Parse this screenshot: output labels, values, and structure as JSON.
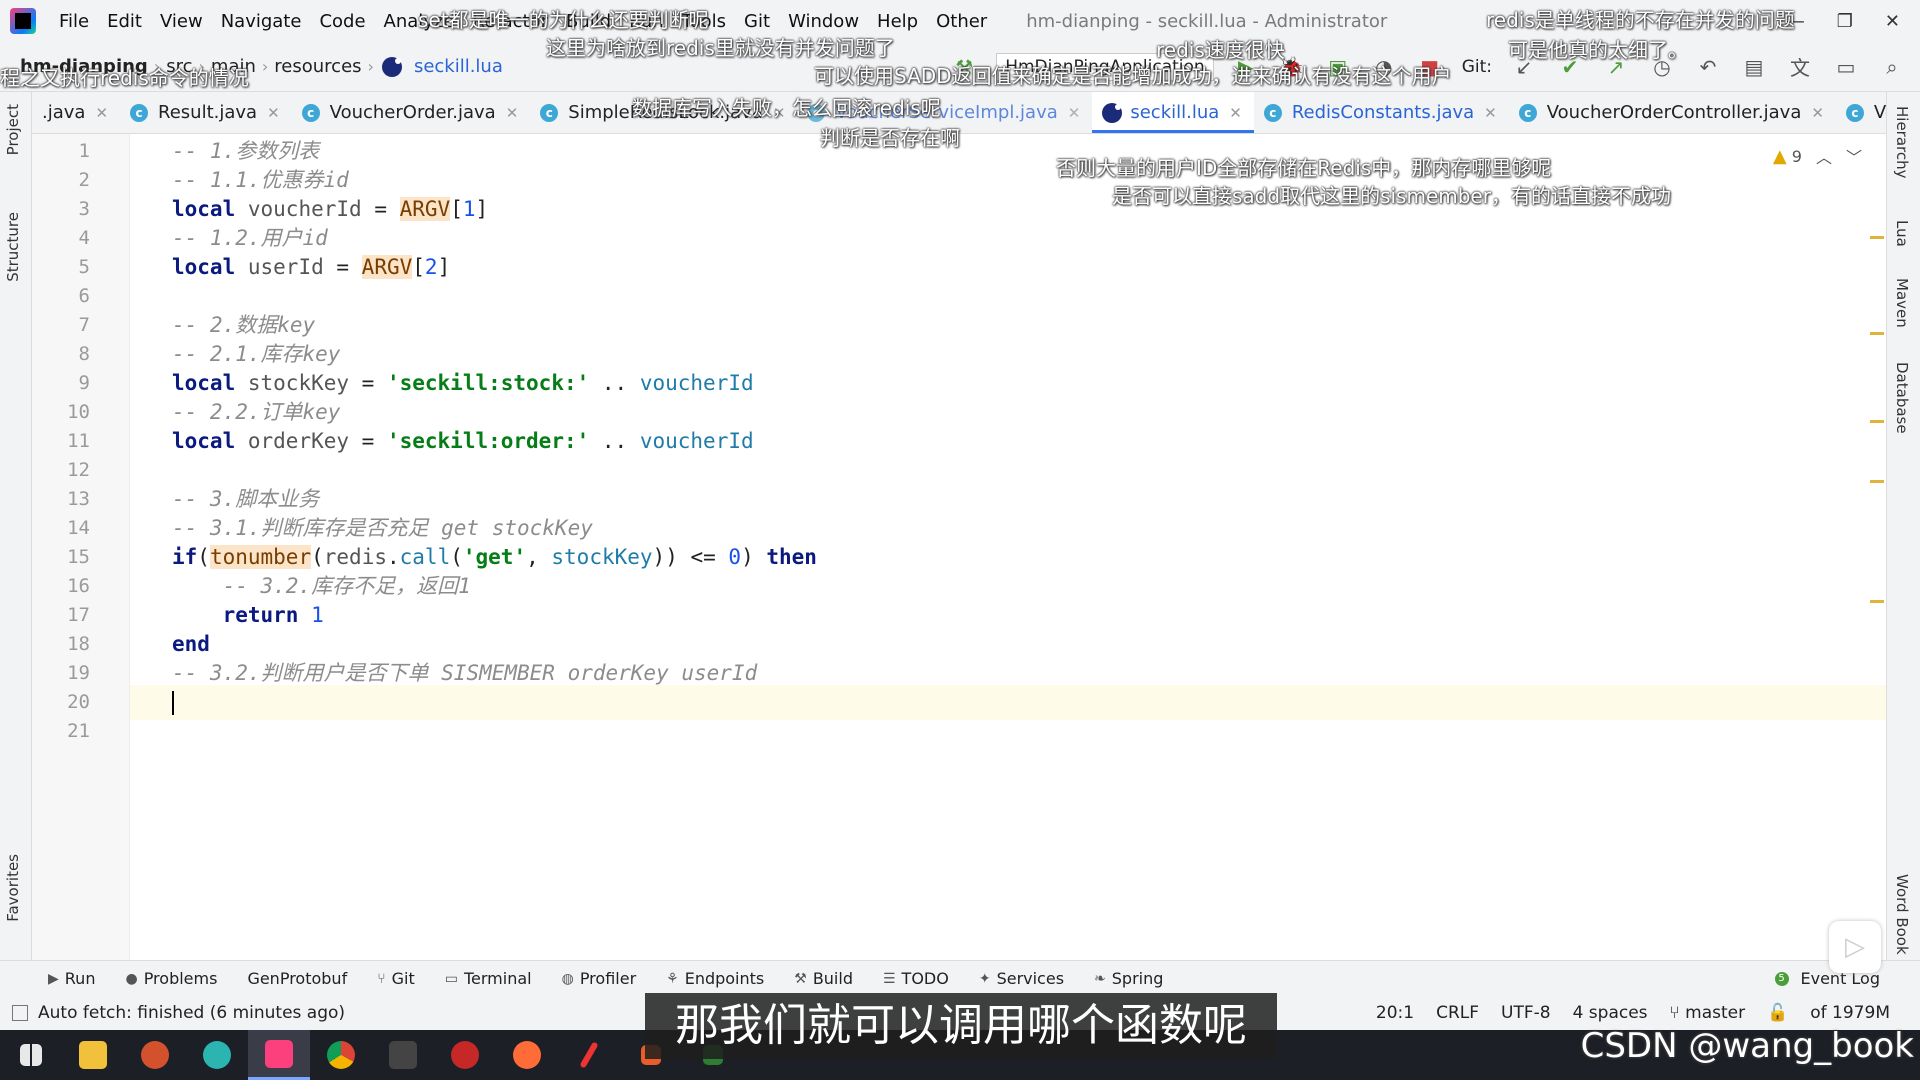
{
  "menubar": {
    "items": [
      "File",
      "Edit",
      "View",
      "Navigate",
      "Code",
      "Analyze",
      "Refactor",
      "Build",
      "Run",
      "Tools",
      "Git",
      "Window",
      "Help",
      "Other"
    ],
    "window_title": "hm-dianping - seckill.lua - Administrator"
  },
  "breadcrumb": {
    "items": [
      "hm-dianping",
      "src",
      "main",
      "resources"
    ],
    "file": "seckill.lua"
  },
  "toolbar": {
    "run_config": "HmDianPingApplication",
    "git_label": "Git:"
  },
  "tabs": [
    {
      "label": ".java",
      "type": "plain"
    },
    {
      "label": "Result.java",
      "type": "class"
    },
    {
      "label": "VoucherOrder.java",
      "type": "class"
    },
    {
      "label": "SimpleRedisLock.java",
      "type": "class"
    },
    {
      "label": "VoucherServiceImpl.java",
      "type": "class"
    },
    {
      "label": "seckill.lua",
      "type": "lua",
      "active": true
    },
    {
      "label": "RedisConstants.java",
      "type": "class"
    },
    {
      "label": "VoucherOrderController.java",
      "type": "class"
    },
    {
      "label": "Voucher",
      "type": "class"
    }
  ],
  "editor": {
    "warning_count": "9",
    "current_line": 20,
    "lines": [
      "-- 1.参数列表",
      "-- 1.1.优惠券id",
      "local voucherId = ARGV[1]",
      "-- 1.2.用户id",
      "local userId = ARGV[2]",
      "",
      "-- 2.数据key",
      "-- 2.1.库存key",
      "local stockKey = 'seckill:stock:' .. voucherId",
      "-- 2.2.订单key",
      "local orderKey = 'seckill:order:' .. voucherId",
      "",
      "-- 3.脚本业务",
      "-- 3.1.判断库存是否充足 get stockKey",
      "if(tonumber(redis.call('get', stockKey)) <= 0) then",
      "    -- 3.2.库存不足，返回1",
      "    return 1",
      "end",
      "-- 3.2.判断用户是否下单 SISMEMBER orderKey userId",
      "",
      ""
    ]
  },
  "left_tools": [
    "Project",
    "Structure",
    "Favorites"
  ],
  "right_tools": [
    "Hierarchy",
    "Lua",
    "Maven",
    "Database",
    "Word Book"
  ],
  "bottom_tools": [
    "Run",
    "Problems",
    "GenProtobuf",
    "Git",
    "Terminal",
    "Profiler",
    "Endpoints",
    "Build",
    "TODO",
    "Services",
    "Spring"
  ],
  "event_log": "Event Log",
  "status": {
    "message": "Auto fetch: finished (6 minutes ago)",
    "position": "20:1",
    "line_sep": "CRLF",
    "encoding": "UTF-8",
    "indent": "4 spaces",
    "branch": "master",
    "memory": "of 1979M"
  },
  "overlays": {
    "subtitle": "那我们就可以调用哪个函数呢",
    "watermark": "CSDN @wang_book",
    "danmaku": [
      "set都是唯一的为什么还要判断呢",
      "这里为啥放到redis里就没有并发问题了",
      "redis是单线程的不存在并发的问题",
      "可是他真的太细了。",
      "redis速度很快",
      "可以使用SADD返回值来确定是否能增加成功，进来确认有没有这个用户",
      "程之又执行redis命令的情况",
      "数据库写入失败，怎么回滚redis呢",
      "判断是否存在啊",
      "否则大量的用户ID全部存储在Redis中，那内存哪里够呢",
      "是否可以直接sadd取代这里的sismember，有的话直接不成功"
    ]
  },
  "colors": {
    "keyword": "#0b1a80",
    "string": "#067d17",
    "comment": "#8c8c8c",
    "accent": "#3574f0"
  }
}
